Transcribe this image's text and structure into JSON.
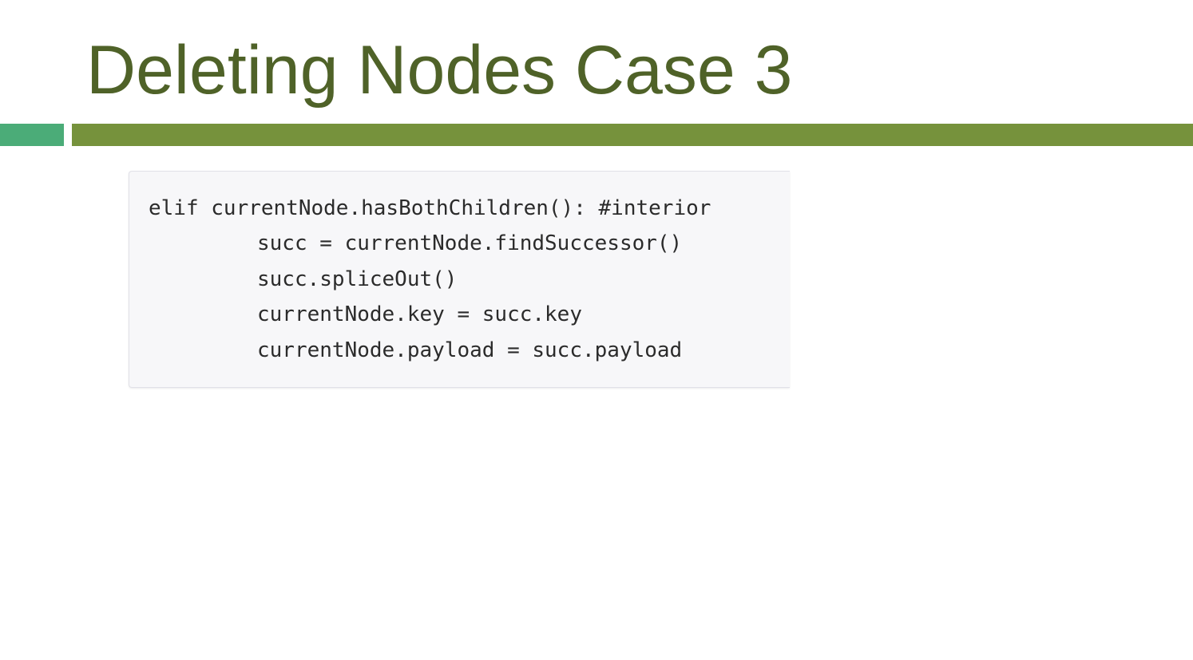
{
  "slide": {
    "title": "Deleting Nodes Case 3",
    "colors": {
      "title": "#4f6228",
      "accent_left": "#4bac78",
      "accent_main": "#76923c",
      "code_background": "#f7f7f9"
    }
  },
  "code": {
    "lines": [
      "elif currentNode.hasBothChildren(): #interior",
      "succ = currentNode.findSuccessor()",
      "succ.spliceOut()",
      "currentNode.key = succ.key",
      "currentNode.payload = succ.payload"
    ]
  }
}
